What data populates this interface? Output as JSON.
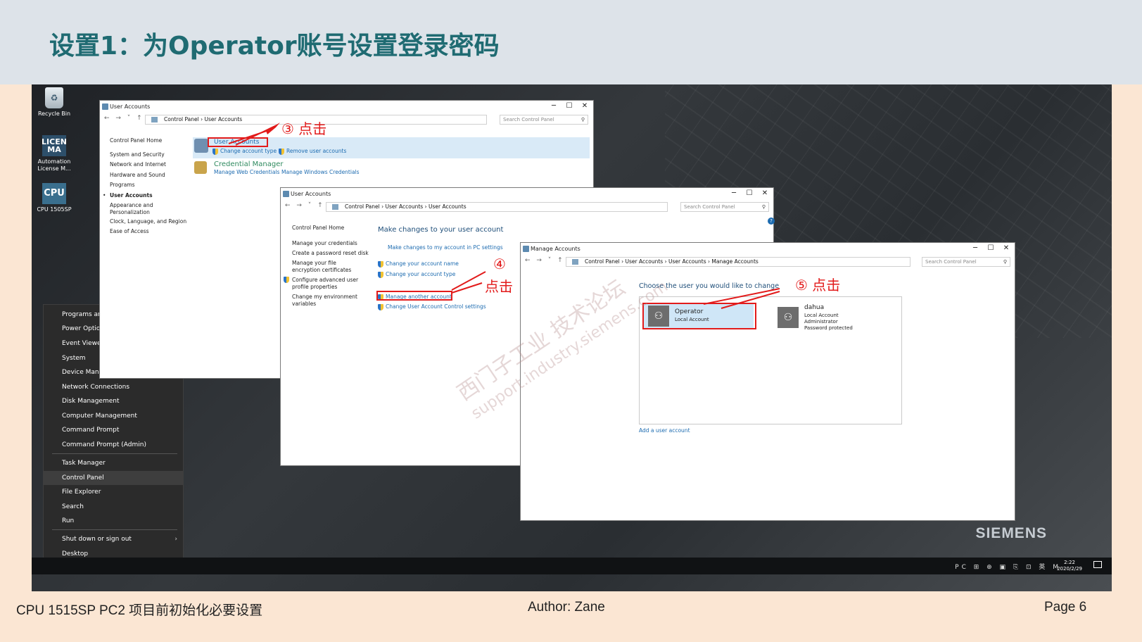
{
  "slide": {
    "title": "设置1：为Operator账号设置登录密码",
    "footer_left": "CPU 1515SP PC2 项目前初始化必要设置",
    "footer_center": "Author:  Zane",
    "footer_right": "Page  6"
  },
  "desktop": {
    "icons": [
      {
        "label": "Recycle Bin",
        "glyph": "♻"
      },
      {
        "label": "Automation License M...",
        "glyph": "LICEN MA"
      },
      {
        "label": "CPU 1505SP",
        "glyph": "CPU"
      }
    ],
    "brand": "SIEMENS",
    "watermark_line1": "西门子工业 技术论坛",
    "watermark_line2": "support.industry.siemens.com"
  },
  "winx_menu": {
    "items": [
      "Programs and Features",
      "Power Options",
      "Event Viewer",
      "System",
      "Device Manager",
      "Network Connections",
      "Disk Management",
      "Computer Management",
      "Command Prompt",
      "Command Prompt (Admin)",
      "Task Manager",
      "Control Panel",
      "File Explorer",
      "Search",
      "Run",
      "Shut down or sign out",
      "Desktop"
    ],
    "active": "Control Panel"
  },
  "window1": {
    "title": "User Accounts",
    "path": [
      "Control Panel",
      "User Accounts"
    ],
    "search_placeholder": "Search Control Panel",
    "sidebar": [
      "Control Panel Home",
      "System and Security",
      "Network and Internet",
      "Hardware and Sound",
      "Programs",
      "User Accounts",
      "Appearance and Personalization",
      "Clock, Language, and Region",
      "Ease of Access"
    ],
    "sidebar_active": "User Accounts",
    "section1_title": "User Accounts",
    "section1_links": [
      "Change account type",
      "Remove user accounts"
    ],
    "section2_title": "Credential Manager",
    "section2_links": [
      "Manage Web Credentials",
      "Manage Windows Credentials"
    ],
    "callout": "③  点击"
  },
  "window2": {
    "title": "User Accounts",
    "path": [
      "Control Panel",
      "User Accounts",
      "User Accounts"
    ],
    "search_placeholder": "Search Control Panel",
    "sidebar": [
      "Control Panel Home",
      "Manage your credentials",
      "Create a password reset disk",
      "Manage your file encryption certificates",
      "Configure advanced user profile properties",
      "Change my environment variables"
    ],
    "heading": "Make changes to your user account",
    "links": [
      "Make changes to my account in PC settings",
      "Change your account name",
      "Change your account type",
      "Manage another account",
      "Change User Account Control settings"
    ],
    "callout_num": "④",
    "callout_text": "点击"
  },
  "window3": {
    "title": "Manage Accounts",
    "path": [
      "Control Panel",
      "User Accounts",
      "User Accounts",
      "Manage Accounts"
    ],
    "search_placeholder": "Search Control Panel",
    "heading": "Choose the user you would like to change",
    "accounts": [
      {
        "name": "Operator",
        "details": [
          "Local Account"
        ]
      },
      {
        "name": "dahua",
        "details": [
          "Local Account",
          "Administrator",
          "Password protected"
        ]
      }
    ],
    "add_link": "Add a user account",
    "callout": "⑤  点击"
  },
  "taskbar": {
    "time": "2:22",
    "date": "2020/2/29",
    "tray_icons": "PC ⊞ ⊕ ▣ ⎘ ⊡ 英 M"
  }
}
